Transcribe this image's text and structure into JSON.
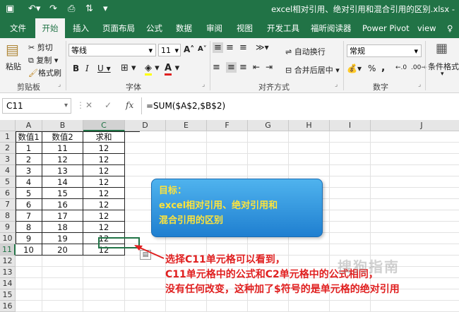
{
  "titlebar": {
    "save_icon": "save-icon",
    "undo_icon": "undo-icon",
    "redo_icon": "redo-icon",
    "preview_icon": "print-preview-icon",
    "sort_icon": "sort-icon",
    "more_icon": "more-icon",
    "title": "excel相对引用、绝对引用和混合引用的区别.xlsx -"
  },
  "tabs": [
    "文件",
    "开始",
    "插入",
    "页面布局",
    "公式",
    "数据",
    "审阅",
    "视图",
    "开发工具",
    "福昕阅读器",
    "Power Pivot",
    "view"
  ],
  "active_tab": "开始",
  "ribbon": {
    "clipboard": {
      "paste": "粘贴",
      "cut": "剪切",
      "copy": "复制",
      "format_painter": "格式刷",
      "label": "剪贴板"
    },
    "font": {
      "name": "等线",
      "size": "11",
      "bold": "B",
      "italic": "I",
      "underline": "U",
      "grow": "A",
      "shrink": "A",
      "label": "字体"
    },
    "alignment": {
      "wrap": "自动换行",
      "merge": "合并后居中",
      "label": "对齐方式"
    },
    "number": {
      "format": "常规",
      "percent": "%",
      "comma": ",",
      "label": "数字"
    },
    "styles": {
      "conditional": "条件格式"
    }
  },
  "formula_bar": {
    "name_box": "C11",
    "cancel": "✕",
    "enter": "✓",
    "fx": "fx",
    "formula": "=SUM($A$2,$B$2)"
  },
  "sheet": {
    "columns": [
      "A",
      "B",
      "C",
      "D",
      "E",
      "F",
      "G",
      "H",
      "I",
      "J"
    ],
    "rows": [
      "1",
      "2",
      "3",
      "4",
      "5",
      "6",
      "7",
      "8",
      "9",
      "10",
      "11",
      "12",
      "13",
      "14",
      "15",
      "16"
    ],
    "table": [
      [
        "数值1",
        "数值2",
        "求和"
      ],
      [
        "1",
        "11",
        "12"
      ],
      [
        "2",
        "12",
        "12"
      ],
      [
        "3",
        "13",
        "12"
      ],
      [
        "4",
        "14",
        "12"
      ],
      [
        "5",
        "15",
        "12"
      ],
      [
        "6",
        "16",
        "12"
      ],
      [
        "7",
        "17",
        "12"
      ],
      [
        "8",
        "18",
        "12"
      ],
      [
        "9",
        "19",
        "12"
      ],
      [
        "10",
        "20",
        "12"
      ]
    ],
    "selected_cell": "C11"
  },
  "callout": {
    "line1": "目标：",
    "line2": "excel相对引用、绝对引用和",
    "line3": "混合引用的区别"
  },
  "annotation": {
    "line1": "选择C11单元格可以看到，",
    "line2": "C11单元格中的公式和C2单元格中的公式相同，",
    "line3": "没有任何改变，这种加了$符号的是单元格的绝对引用"
  },
  "watermark": "搜狗指南"
}
